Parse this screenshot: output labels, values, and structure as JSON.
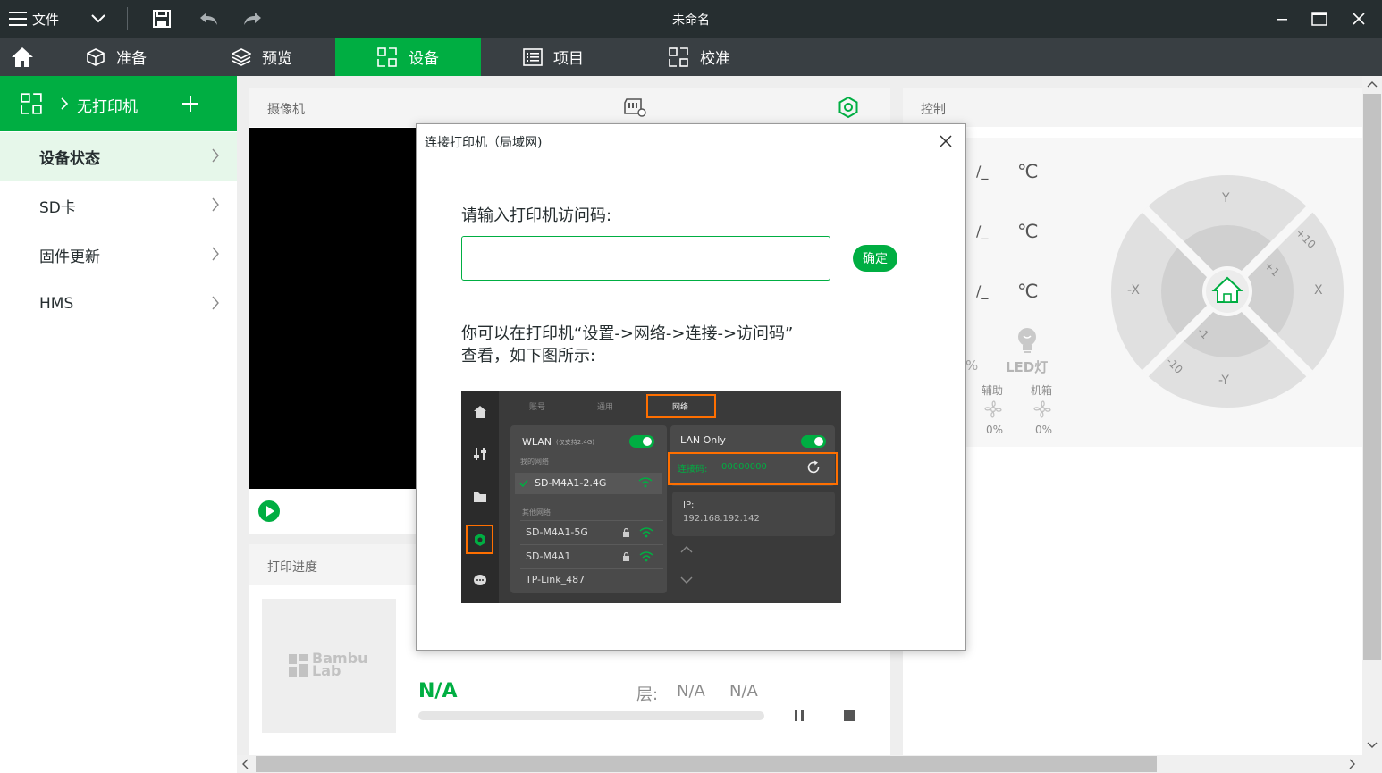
{
  "titlebar": {
    "menu_label": "文件",
    "title": "未命名"
  },
  "nav": {
    "tabs": [
      {
        "label": "准备"
      },
      {
        "label": "预览"
      },
      {
        "label": "设备"
      },
      {
        "label": "项目"
      },
      {
        "label": "校准"
      }
    ],
    "active": "设备"
  },
  "sidebar": {
    "printer_label": "无打印机",
    "items": [
      {
        "label": "设备状态"
      },
      {
        "label": "SD卡"
      },
      {
        "label": "固件更新"
      },
      {
        "label": "HMS"
      }
    ]
  },
  "camera": {
    "title": "摄像机"
  },
  "progress": {
    "title": "打印进度",
    "status": "N/A",
    "layer_label": "层:",
    "layer_value": "N/A",
    "time_value": "N/A",
    "logo_line1": "Bambu",
    "logo_line2": "Lab",
    "percent": 0
  },
  "control": {
    "title": "控制",
    "temps": [
      {
        "value": "/_",
        "unit": "℃"
      },
      {
        "value": "/_",
        "unit": "℃"
      },
      {
        "value": "/_",
        "unit": "℃"
      }
    ],
    "percent_symbol": "%",
    "led_label": "LED灯",
    "fans": [
      {
        "label": "辅助",
        "value": "0%"
      },
      {
        "label": "机箱",
        "value": "0%"
      }
    ],
    "jog": {
      "y_plus": "Y",
      "y_minus": "-Y",
      "x_plus": "X",
      "x_minus": "-X",
      "plus10": "+10",
      "plus1": "+1",
      "minus1": "-1",
      "minus10": "-10"
    }
  },
  "dialog": {
    "title": "连接打印机（局域网)",
    "prompt": "请输入打印机访问码:",
    "input_value": "",
    "confirm_label": "确定",
    "hint_line1": "你可以在打印机“设置->网络->连接->访问码”",
    "hint_line2": "查看，如下图所示:",
    "example": {
      "tabs": [
        "账号",
        "通用",
        "网络"
      ],
      "wlan_label": "WLAN",
      "wlan_note": "(仅支持2.4G)",
      "my_network_label": "我的网络",
      "connected_network": "SD-M4A1-2.4G",
      "other_networks_label": "其他网络",
      "networks": [
        "SD-M4A1-5G",
        "SD-M4A1",
        "TP-Link_487"
      ],
      "lan_label": "LAN Only",
      "access_code_label": "连接码:",
      "access_code": "00000000",
      "ip_label": "IP:",
      "ip_value": "192.168.192.142"
    }
  },
  "colors": {
    "brand_green": "#00ae42",
    "titlebar": "#262e30",
    "navbar": "#393f43",
    "highlight": "#ff6f00"
  }
}
